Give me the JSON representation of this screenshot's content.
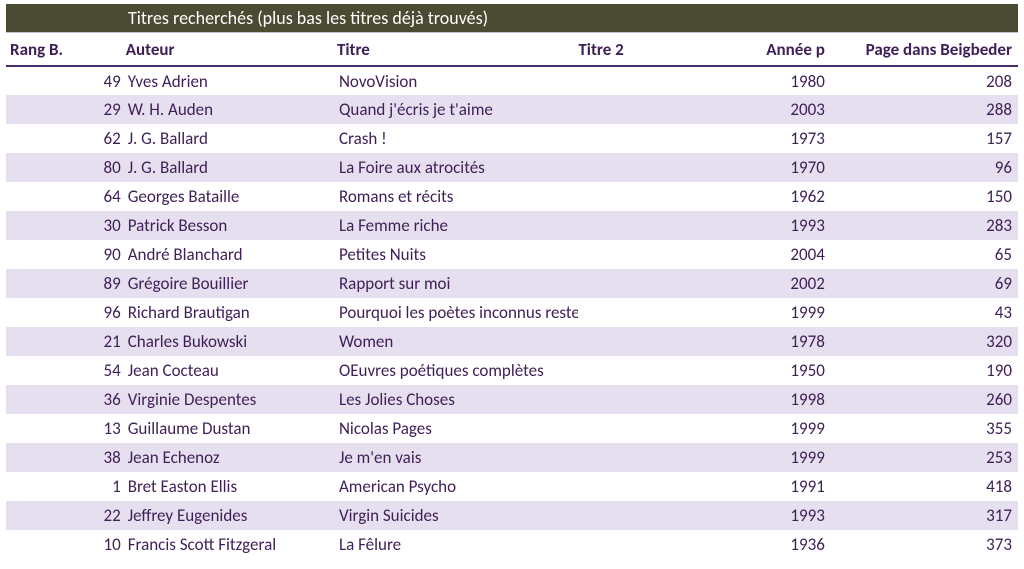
{
  "chart_data": {
    "type": "table",
    "title": "Titres recherchés (plus bas les titres déjà trouvés)",
    "columns": [
      "Rang B.",
      "Auteur",
      "Titre",
      "Titre 2",
      "Année p",
      "Page dans Beigbeder"
    ],
    "rows": [
      {
        "rang": 49,
        "auteur": "Yves Adrien",
        "titre": "NovoVision",
        "titre2": "",
        "annee": 1980,
        "page": 208
      },
      {
        "rang": 29,
        "auteur": "W. H. Auden",
        "titre": "Quand j'écris je t'aime",
        "titre2": "",
        "annee": 2003,
        "page": 288
      },
      {
        "rang": 62,
        "auteur": "J. G. Ballard",
        "titre": "Crash !",
        "titre2": "",
        "annee": 1973,
        "page": 157
      },
      {
        "rang": 80,
        "auteur": "J. G. Ballard",
        "titre": "La Foire aux atrocités",
        "titre2": "",
        "annee": 1970,
        "page": 96
      },
      {
        "rang": 64,
        "auteur": "Georges Bataille",
        "titre": "Romans et récits",
        "titre2": "",
        "annee": 1962,
        "page": 150
      },
      {
        "rang": 30,
        "auteur": "Patrick Besson",
        "titre": "La Femme riche",
        "titre2": "",
        "annee": 1993,
        "page": 283
      },
      {
        "rang": 90,
        "auteur": "André Blanchard",
        "titre": "Petites Nuits",
        "titre2": "",
        "annee": 2004,
        "page": 65
      },
      {
        "rang": 89,
        "auteur": "Grégoire Bouillier",
        "titre": "Rapport sur moi",
        "titre2": "",
        "annee": 2002,
        "page": 69
      },
      {
        "rang": 96,
        "auteur": "Richard Brautigan",
        "titre": "Pourquoi les poètes inconnus restent inconnus",
        "titre2": "",
        "annee": 1999,
        "page": 43
      },
      {
        "rang": 21,
        "auteur": "Charles Bukowski",
        "titre": "Women",
        "titre2": "",
        "annee": 1978,
        "page": 320
      },
      {
        "rang": 54,
        "auteur": "Jean Cocteau",
        "titre": "OEuvres poétiques complètes",
        "titre2": "",
        "annee": 1950,
        "page": 190
      },
      {
        "rang": 36,
        "auteur": "Virginie Despentes",
        "titre": "Les Jolies Choses",
        "titre2": "",
        "annee": 1998,
        "page": 260
      },
      {
        "rang": 13,
        "auteur": "Guillaume Dustan",
        "titre": "Nicolas Pages",
        "titre2": "",
        "annee": 1999,
        "page": 355
      },
      {
        "rang": 38,
        "auteur": "Jean Echenoz",
        "titre": "Je m'en vais",
        "titre2": "",
        "annee": 1999,
        "page": 253
      },
      {
        "rang": 1,
        "auteur": "Bret Easton Ellis",
        "titre": "American Psycho",
        "titre2": "",
        "annee": 1991,
        "page": 418
      },
      {
        "rang": 22,
        "auteur": "Jeffrey Eugenides",
        "titre": "Virgin Suicides",
        "titre2": "",
        "annee": 1993,
        "page": 317
      },
      {
        "rang": 10,
        "auteur": "Francis Scott Fitzgerald",
        "titre": "La Fêlure",
        "titre2": "",
        "annee": 1936,
        "page": 373
      }
    ]
  },
  "table": {
    "title": "Titres recherchés (plus bas les titres déjà trouvés)",
    "headers": {
      "rang": "Rang B.",
      "auteur": "Auteur",
      "titre": "Titre",
      "titre2": "Titre 2",
      "annee": "Année p",
      "page": "Page dans Beigbeder"
    },
    "rows": [
      {
        "rang": "49",
        "auteur": "Yves Adrien",
        "titre": "NovoVision",
        "titre2": "",
        "annee": "1980",
        "page": "208"
      },
      {
        "rang": "29",
        "auteur": "W. H. Auden",
        "titre": "Quand j'écris je t'aime",
        "titre2": "",
        "annee": "2003",
        "page": "288"
      },
      {
        "rang": "62",
        "auteur": "J. G. Ballard",
        "titre": "Crash !",
        "titre2": "",
        "annee": "1973",
        "page": "157"
      },
      {
        "rang": "80",
        "auteur": "J. G. Ballard",
        "titre": "La Foire aux atrocités",
        "titre2": "",
        "annee": "1970",
        "page": "96"
      },
      {
        "rang": "64",
        "auteur": "Georges Bataille",
        "titre": "Romans et récits",
        "titre2": "",
        "annee": "1962",
        "page": "150"
      },
      {
        "rang": "30",
        "auteur": "Patrick Besson",
        "titre": "La Femme riche",
        "titre2": "",
        "annee": "1993",
        "page": "283"
      },
      {
        "rang": "90",
        "auteur": "André Blanchard",
        "titre": "Petites Nuits",
        "titre2": "",
        "annee": "2004",
        "page": "65"
      },
      {
        "rang": "89",
        "auteur": "Grégoire Bouillier",
        "titre": "Rapport sur moi",
        "titre2": "",
        "annee": "2002",
        "page": "69"
      },
      {
        "rang": "96",
        "auteur": "Richard Brautigan",
        "titre": "Pourquoi les poètes inconnus restent inconnus",
        "titre2": "",
        "annee": "1999",
        "page": "43"
      },
      {
        "rang": "21",
        "auteur": "Charles Bukowski",
        "titre": "Women",
        "titre2": "",
        "annee": "1978",
        "page": "320"
      },
      {
        "rang": "54",
        "auteur": "Jean Cocteau",
        "titre": "OEuvres poétiques complètes",
        "titre2": "",
        "annee": "1950",
        "page": "190"
      },
      {
        "rang": "36",
        "auteur": "Virginie Despentes",
        "titre": "Les Jolies Choses",
        "titre2": "",
        "annee": "1998",
        "page": "260"
      },
      {
        "rang": "13",
        "auteur": "Guillaume Dustan",
        "titre": "Nicolas Pages",
        "titre2": "",
        "annee": "1999",
        "page": "355"
      },
      {
        "rang": "38",
        "auteur": "Jean Echenoz",
        "titre": "Je m'en vais",
        "titre2": "",
        "annee": "1999",
        "page": "253"
      },
      {
        "rang": "1",
        "auteur": "Bret Easton Ellis",
        "titre": "American Psycho",
        "titre2": "",
        "annee": "1991",
        "page": "418"
      },
      {
        "rang": "22",
        "auteur": "Jeffrey Eugenides",
        "titre": "Virgin Suicides",
        "titre2": "",
        "annee": "1993",
        "page": "317"
      },
      {
        "rang": "10",
        "auteur": "Francis Scott Fitzgeral",
        "titre": "La Fêlure",
        "titre2": "",
        "annee": "1936",
        "page": "373"
      }
    ]
  }
}
